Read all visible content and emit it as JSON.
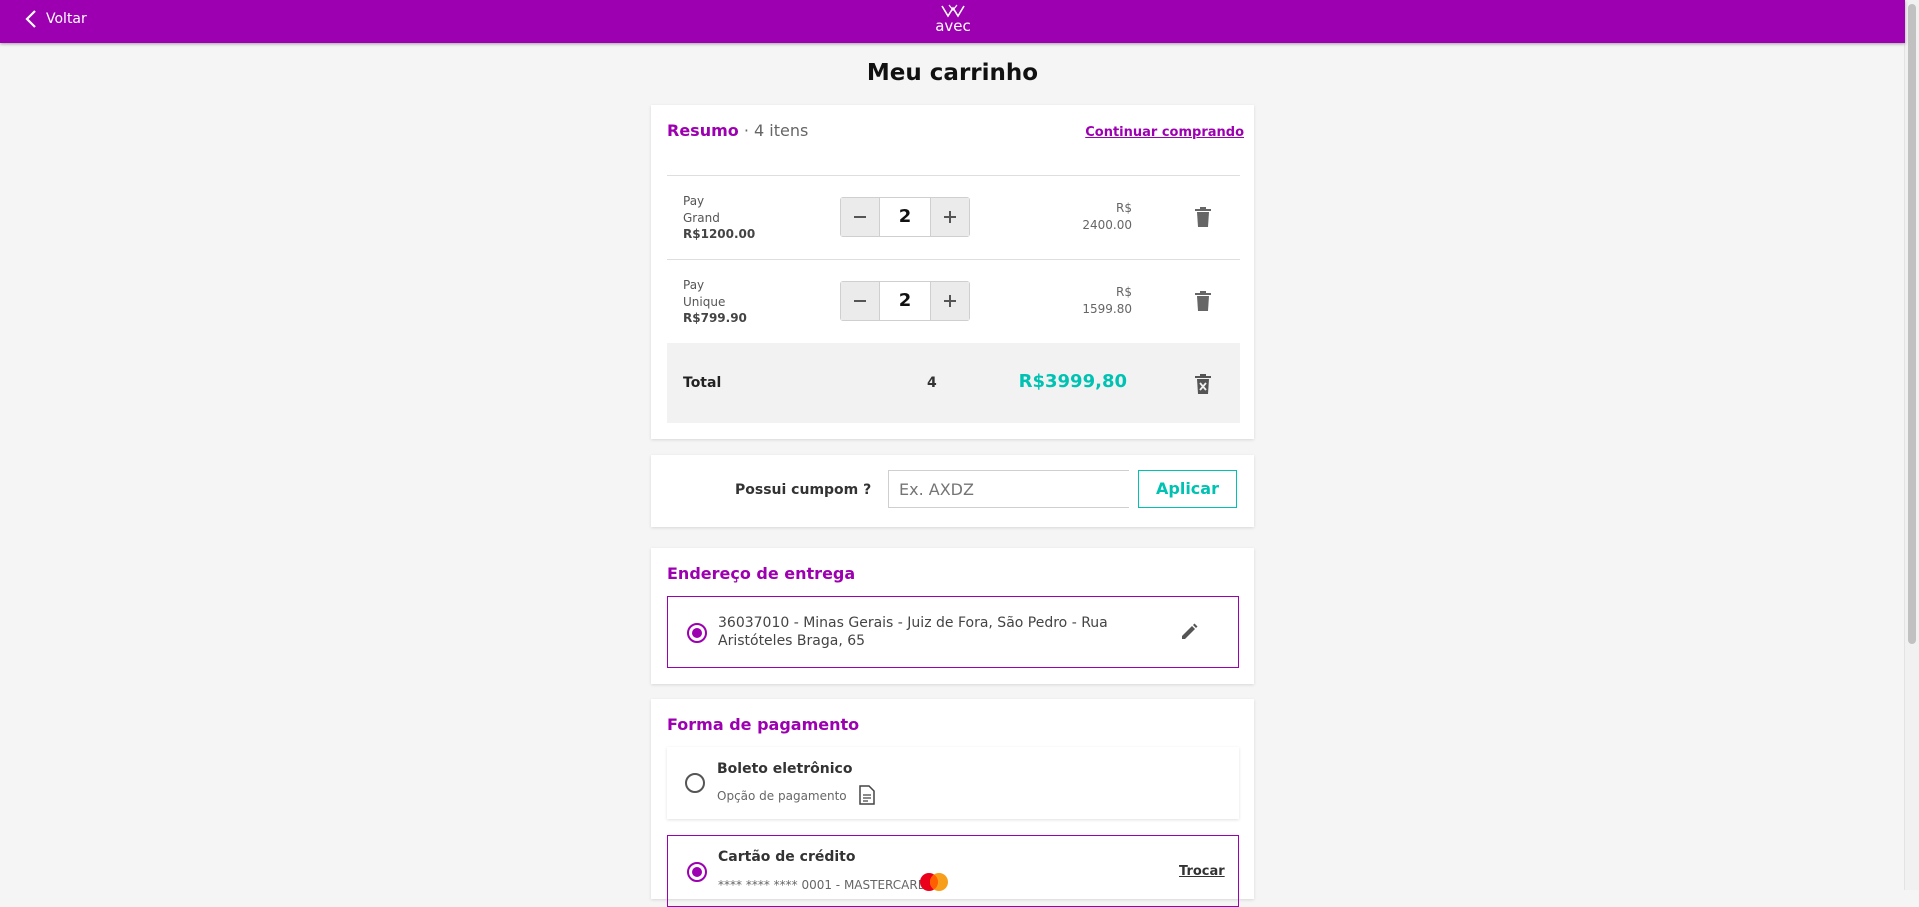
{
  "header": {
    "back_label": "Voltar",
    "logo_text": "avec"
  },
  "page": {
    "title": "Meu carrinho"
  },
  "summary": {
    "title": "Resumo",
    "count_text": "· 4 itens",
    "continue_label": "Continuar comprando",
    "items": [
      {
        "name_line1": "Pay",
        "name_line2": "Grand",
        "price": "R$1200.00",
        "qty": "2",
        "total_currency": "R$",
        "total_value": "2400.00"
      },
      {
        "name_line1": "Pay",
        "name_line2": "Unique",
        "price": "R$799.90",
        "qty": "2",
        "total_currency": "R$",
        "total_value": "1599.80"
      }
    ],
    "total_label": "Total",
    "total_qty": "4",
    "total_value": "R$3999,80"
  },
  "coupon": {
    "label": "Possui cumpom ?",
    "placeholder": "Ex. AXDZ",
    "apply_label": "Aplicar"
  },
  "address": {
    "title": "Endereço de entrega",
    "line1": "36037010 - Minas Gerais - Juiz de Fora, São Pedro - Rua",
    "line2": "Aristóteles Braga, 65"
  },
  "payment": {
    "title": "Forma de pagamento",
    "boleto_title": "Boleto eletrônico",
    "boleto_sub": "Opção de pagamento",
    "card_title": "Cartão de crédito",
    "card_sub": "**** **** **** 0001 - MASTERCARD",
    "change_label": "Trocar"
  },
  "colors": {
    "brand": "#9c00b0",
    "accent": "#00c2b3"
  },
  "icons": [
    "chevron-left-icon",
    "avec-logo-icon",
    "minus-icon",
    "plus-icon",
    "trash-icon",
    "clear-cart-icon",
    "radio-icon",
    "edit-icon",
    "document-icon",
    "mastercard-icon"
  ]
}
